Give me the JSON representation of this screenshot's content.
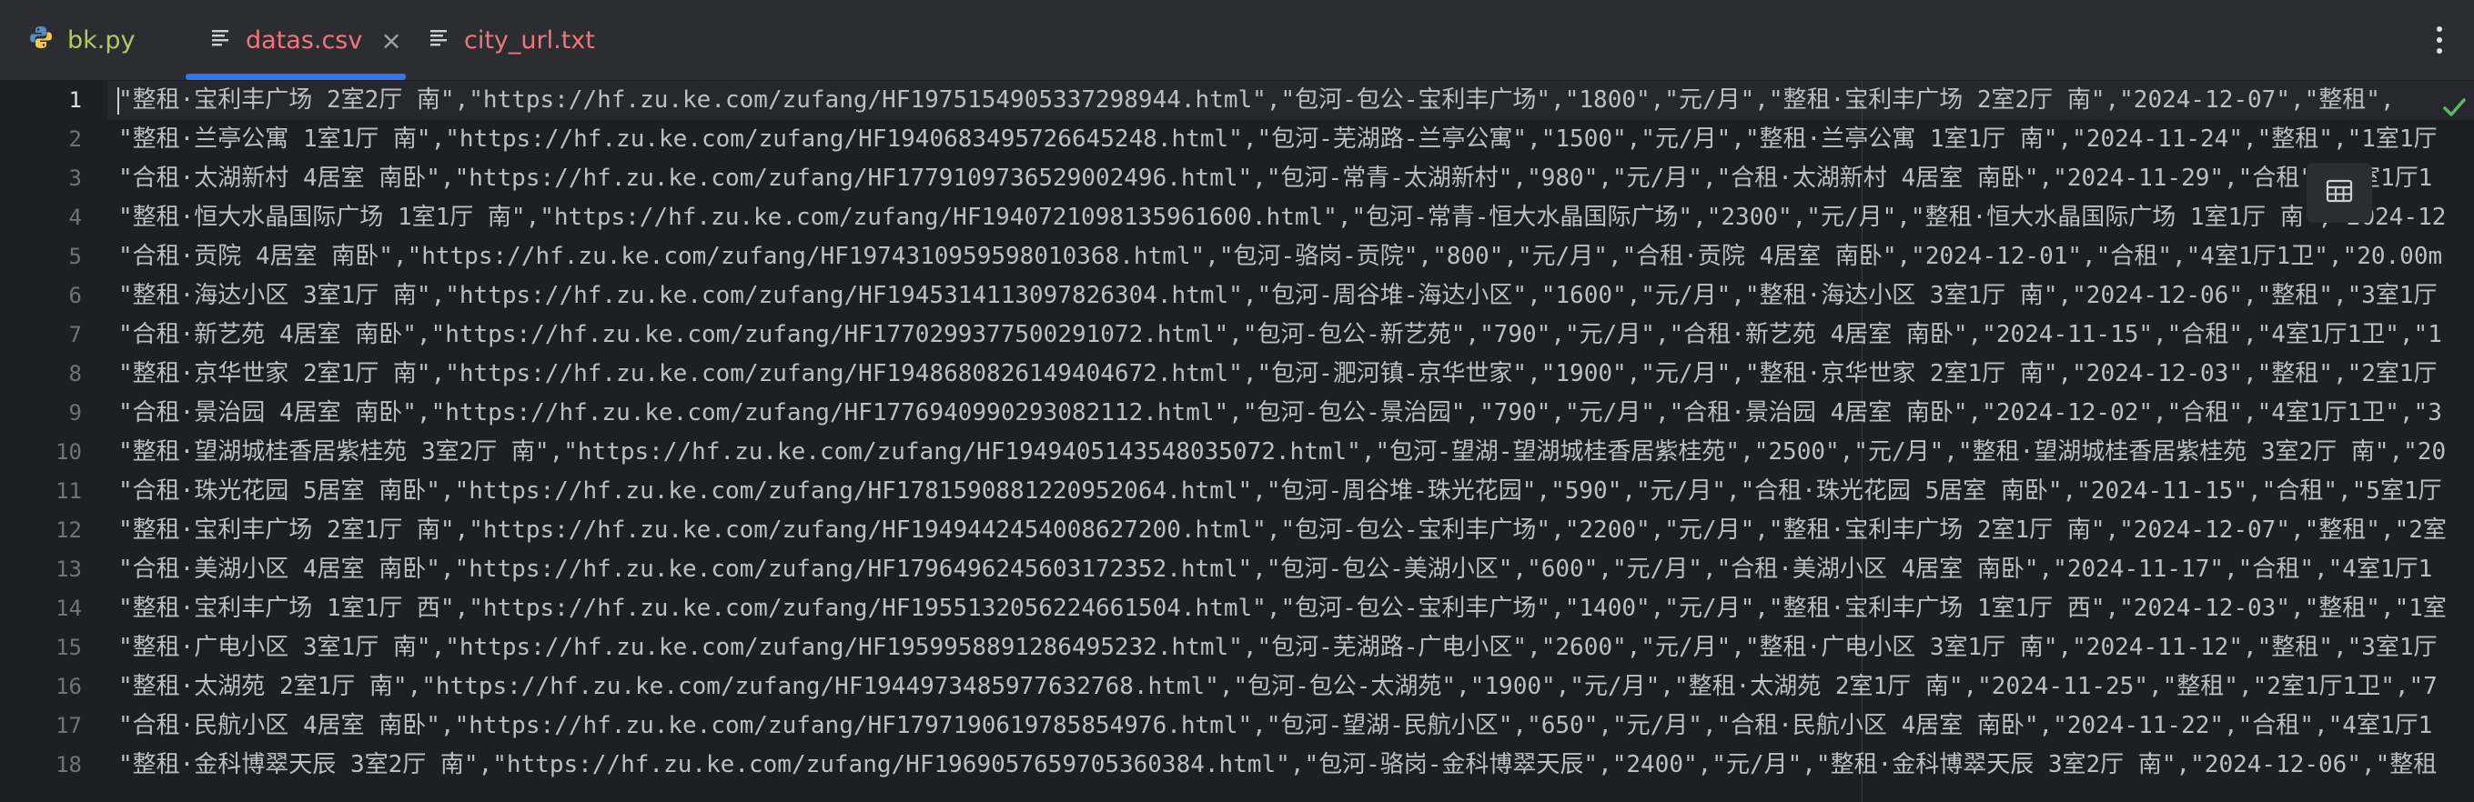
{
  "tabs": [
    {
      "label": "bk.py",
      "icon": "python-icon",
      "active": false,
      "color": "#b5c95a"
    },
    {
      "label": "datas.csv",
      "icon": "csv-file-icon",
      "active": true,
      "color": "#f2757b"
    },
    {
      "label": "city_url.txt",
      "icon": "text-file-icon",
      "active": false,
      "color": "#f2757b"
    }
  ],
  "editor": {
    "current_line": 1,
    "lines": [
      {
        "n": "1",
        "text": "\"整租·宝利丰广场 2室2厅 南\",\"https://hf.zu.ke.com/zufang/HF1975154905337298944.html\",\"包河-包公-宝利丰广场\",\"1800\",\"元/月\",\"整租·宝利丰广场 2室2厅 南\",\"2024-12-07\",\"整租\","
      },
      {
        "n": "2",
        "text": "\"整租·兰亭公寓 1室1厅 南\",\"https://hf.zu.ke.com/zufang/HF1940683495726645248.html\",\"包河-芜湖路-兰亭公寓\",\"1500\",\"元/月\",\"整租·兰亭公寓 1室1厅 南\",\"2024-11-24\",\"整租\",\"1室1厅"
      },
      {
        "n": "3",
        "text": "\"合租·太湖新村 4居室 南卧\",\"https://hf.zu.ke.com/zufang/HF1779109736529002496.html\",\"包河-常青-太湖新村\",\"980\",\"元/月\",\"合租·太湖新村 4居室 南卧\",\"2024-11-29\",\"合租\",\"4室1厅1"
      },
      {
        "n": "4",
        "text": "\"整租·恒大水晶国际广场 1室1厅 南\",\"https://hf.zu.ke.com/zufang/HF1940721098135961600.html\",\"包河-常青-恒大水晶国际广场\",\"2300\",\"元/月\",\"整租·恒大水晶国际广场 1室1厅 南\",\"2024-12"
      },
      {
        "n": "5",
        "text": "\"合租·贡院 4居室 南卧\",\"https://hf.zu.ke.com/zufang/HF1974310959598010368.html\",\"包河-骆岗-贡院\",\"800\",\"元/月\",\"合租·贡院 4居室 南卧\",\"2024-12-01\",\"合租\",\"4室1厅1卫\",\"20.00m"
      },
      {
        "n": "6",
        "text": "\"整租·海达小区 3室1厅 南\",\"https://hf.zu.ke.com/zufang/HF1945314113097826304.html\",\"包河-周谷堆-海达小区\",\"1600\",\"元/月\",\"整租·海达小区 3室1厅 南\",\"2024-12-06\",\"整租\",\"3室1厅"
      },
      {
        "n": "7",
        "text": "\"合租·新艺苑 4居室 南卧\",\"https://hf.zu.ke.com/zufang/HF1770299377500291072.html\",\"包河-包公-新艺苑\",\"790\",\"元/月\",\"合租·新艺苑 4居室 南卧\",\"2024-11-15\",\"合租\",\"4室1厅1卫\",\"1"
      },
      {
        "n": "8",
        "text": "\"整租·京华世家 2室1厅 南\",\"https://hf.zu.ke.com/zufang/HF1948680826149404672.html\",\"包河-淝河镇-京华世家\",\"1900\",\"元/月\",\"整租·京华世家 2室1厅 南\",\"2024-12-03\",\"整租\",\"2室1厅"
      },
      {
        "n": "9",
        "text": "\"合租·景治园 4居室 南卧\",\"https://hf.zu.ke.com/zufang/HF1776940990293082112.html\",\"包河-包公-景治园\",\"790\",\"元/月\",\"合租·景治园 4居室 南卧\",\"2024-12-02\",\"合租\",\"4室1厅1卫\",\"3"
      },
      {
        "n": "10",
        "text": "\"整租·望湖城桂香居紫桂苑 3室2厅 南\",\"https://hf.zu.ke.com/zufang/HF1949405143548035072.html\",\"包河-望湖-望湖城桂香居紫桂苑\",\"2500\",\"元/月\",\"整租·望湖城桂香居紫桂苑 3室2厅 南\",\"20"
      },
      {
        "n": "11",
        "text": "\"合租·珠光花园 5居室 南卧\",\"https://hf.zu.ke.com/zufang/HF1781590881220952064.html\",\"包河-周谷堆-珠光花园\",\"590\",\"元/月\",\"合租·珠光花园 5居室 南卧\",\"2024-11-15\",\"合租\",\"5室1厅"
      },
      {
        "n": "12",
        "text": "\"整租·宝利丰广场 2室1厅 南\",\"https://hf.zu.ke.com/zufang/HF1949442454008627200.html\",\"包河-包公-宝利丰广场\",\"2200\",\"元/月\",\"整租·宝利丰广场 2室1厅 南\",\"2024-12-07\",\"整租\",\"2室"
      },
      {
        "n": "13",
        "text": "\"合租·美湖小区 4居室 南卧\",\"https://hf.zu.ke.com/zufang/HF1796496245603172352.html\",\"包河-包公-美湖小区\",\"600\",\"元/月\",\"合租·美湖小区 4居室 南卧\",\"2024-11-17\",\"合租\",\"4室1厅1"
      },
      {
        "n": "14",
        "text": "\"整租·宝利丰广场 1室1厅 西\",\"https://hf.zu.ke.com/zufang/HF1955132056224661504.html\",\"包河-包公-宝利丰广场\",\"1400\",\"元/月\",\"整租·宝利丰广场 1室1厅 西\",\"2024-12-03\",\"整租\",\"1室"
      },
      {
        "n": "15",
        "text": "\"整租·广电小区 3室1厅 南\",\"https://hf.zu.ke.com/zufang/HF1959958891286495232.html\",\"包河-芜湖路-广电小区\",\"2600\",\"元/月\",\"整租·广电小区 3室1厅 南\",\"2024-11-12\",\"整租\",\"3室1厅"
      },
      {
        "n": "16",
        "text": "\"整租·太湖苑 2室1厅 南\",\"https://hf.zu.ke.com/zufang/HF1944973485977632768.html\",\"包河-包公-太湖苑\",\"1900\",\"元/月\",\"整租·太湖苑 2室1厅 南\",\"2024-11-25\",\"整租\",\"2室1厅1卫\",\"7"
      },
      {
        "n": "17",
        "text": "\"合租·民航小区 4居室 南卧\",\"https://hf.zu.ke.com/zufang/HF1797190619785854976.html\",\"包河-望湖-民航小区\",\"650\",\"元/月\",\"合租·民航小区 4居室 南卧\",\"2024-11-22\",\"合租\",\"4室1厅1"
      },
      {
        "n": "18",
        "text": "\"整租·金科博翠天辰 3室2厅 南\",\"https://hf.zu.ke.com/zufang/HF1969057659705360384.html\",\"包河-骆岗-金科博翠天辰\",\"2400\",\"元/月\",\"整租·金科博翠天辰 3室2厅 南\",\"2024-12-06\",\"整租"
      }
    ]
  },
  "indicators": {
    "inspection": "check-icon",
    "table_view": "table-icon",
    "more": "more-vertical-icon"
  },
  "colors": {
    "accent": "#3574f0",
    "check": "#5fb865",
    "background": "#1e1f22"
  }
}
